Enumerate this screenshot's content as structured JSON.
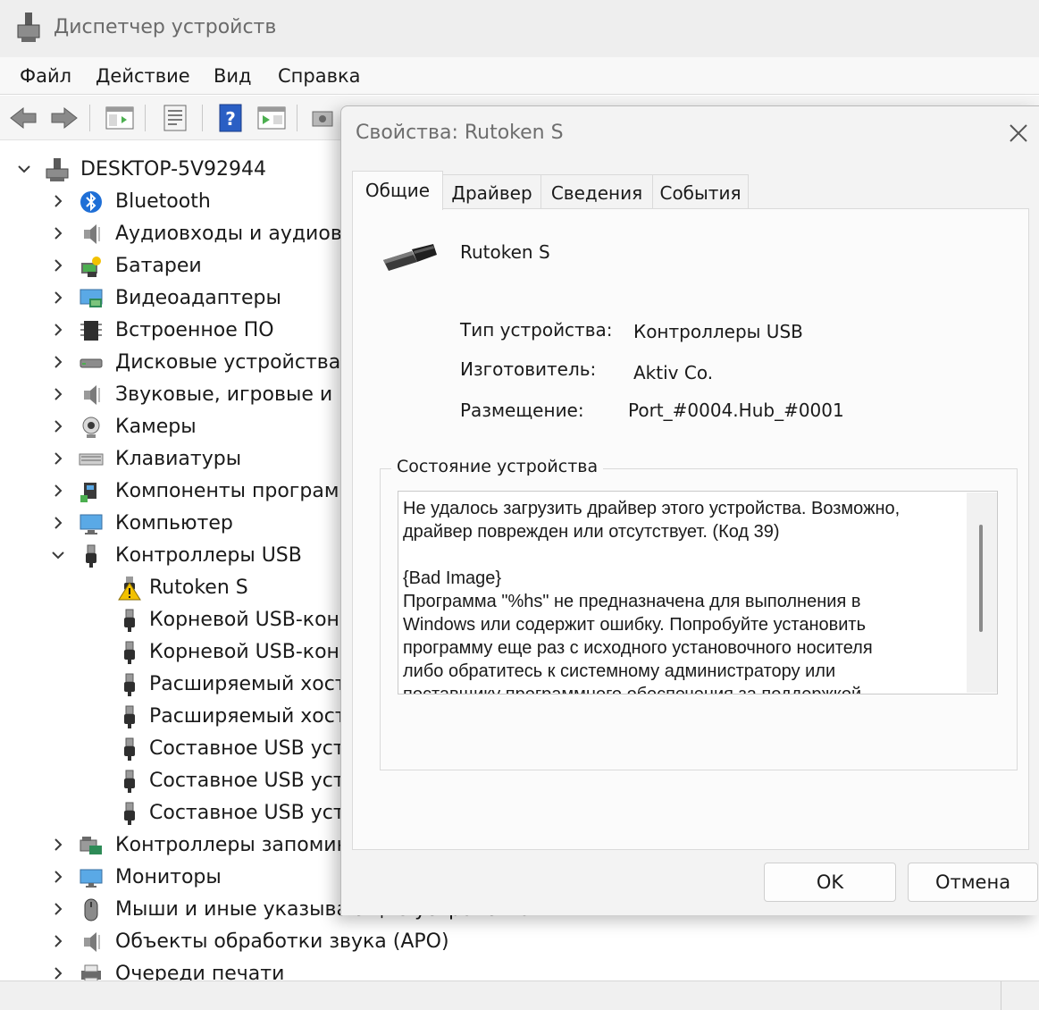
{
  "window": {
    "title": "Диспетчер устройств"
  },
  "menu": {
    "file": "Файл",
    "action": "Действие",
    "view": "Вид",
    "help": "Справка"
  },
  "toolbar": {
    "icons": [
      "back-arrow-icon",
      "forward-arrow-icon",
      "show-hide-console-tree-icon",
      "properties-icon",
      "help-icon",
      "run-icon",
      "scan-hardware-icon"
    ]
  },
  "tree": {
    "root": "DESKTOP-5V92944",
    "categories": [
      {
        "label": "Bluetooth",
        "icon": "bluetooth-icon"
      },
      {
        "label": "Аудиовходы и аудиовых",
        "icon": "speaker-icon"
      },
      {
        "label": "Батареи",
        "icon": "battery-icon"
      },
      {
        "label": "Видеоадаптеры",
        "icon": "display-adapter-icon"
      },
      {
        "label": "Встроенное ПО",
        "icon": "chip-icon"
      },
      {
        "label": "Дисковые устройства",
        "icon": "disk-drive-icon"
      },
      {
        "label": "Звуковые, игровые и ви",
        "icon": "speaker-icon"
      },
      {
        "label": "Камеры",
        "icon": "camera-icon"
      },
      {
        "label": "Клавиатуры",
        "icon": "keyboard-icon"
      },
      {
        "label": "Компоненты программ",
        "icon": "software-component-icon"
      },
      {
        "label": "Компьютер",
        "icon": "computer-icon"
      },
      {
        "label": "Контроллеры USB",
        "icon": "usb-plug-icon",
        "expanded": true
      }
    ],
    "usb_children": [
      {
        "label": "Rutoken S",
        "icon": "warning-icon"
      },
      {
        "label": "Корневой USB-конц",
        "icon": "usb-plug-icon"
      },
      {
        "label": "Корневой USB-конц",
        "icon": "usb-plug-icon"
      },
      {
        "label": "Расширяемый хост-",
        "icon": "usb-plug-icon"
      },
      {
        "label": "Расширяемый хост-",
        "icon": "usb-plug-icon"
      },
      {
        "label": "Составное USB устр",
        "icon": "usb-plug-icon"
      },
      {
        "label": "Составное USB устр",
        "icon": "usb-plug-icon"
      },
      {
        "label": "Составное USB устр",
        "icon": "usb-plug-icon"
      }
    ],
    "after": [
      {
        "label": "Контроллеры запомина",
        "icon": "storage-controller-icon"
      },
      {
        "label": "Мониторы",
        "icon": "monitor-icon"
      },
      {
        "label": "Мыши и иные указывающие устройства",
        "icon": "mouse-icon"
      },
      {
        "label": "Объекты обработки звука (APO)",
        "icon": "speaker-icon"
      },
      {
        "label": "Очереди печати",
        "icon": "printer-icon"
      }
    ]
  },
  "dialog": {
    "title": "Свойства: Rutoken S",
    "tabs": [
      "Общие",
      "Драйвер",
      "Сведения",
      "События"
    ],
    "active_tab": "Общие",
    "device_name": "Rutoken S",
    "props": {
      "type_label": "Тип устройства:",
      "type_value": "Контроллеры USB",
      "manufacturer_label": "Изготовитель:",
      "manufacturer_value": "Aktiv Co.",
      "location_label": "Размещение:",
      "location_value": "Port_#0004.Hub_#0001"
    },
    "status_group_label": "Состояние устройства",
    "status_text": "Не удалось загрузить драйвер этого устройства. Возможно,\nдрайвер поврежден или отсутствует. (Код 39)\n\n{Bad Image}\nПрограмма \"%hs\" не предназначена для выполнения в\nWindows или содержит ошибку. Попробуйте установить\nпрограмму еще раз с исходного установочного носителя\nлибо обратитесь к системному администратору или\nпоставщику программного обеспечения за поддержкой.",
    "ok_button": "OK",
    "cancel_button": "Отмена"
  }
}
